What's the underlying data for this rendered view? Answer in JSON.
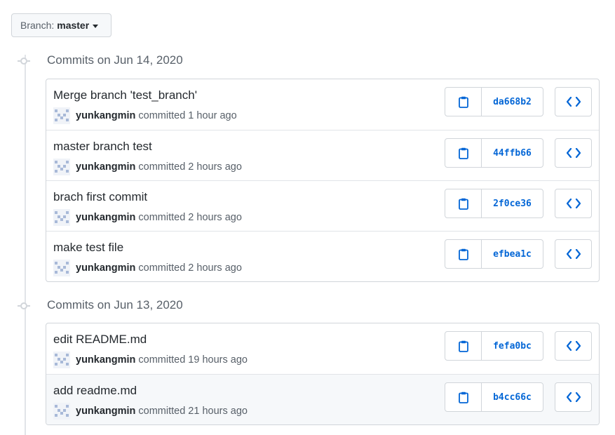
{
  "branch": {
    "label": "Branch:",
    "value": "master"
  },
  "groups": [
    {
      "title": "Commits on Jun 14, 2020",
      "commits": [
        {
          "message": "Merge branch 'test_branch'",
          "author": "yunkangmin",
          "action": "committed",
          "age": "1 hour ago",
          "sha": "da668b2"
        },
        {
          "message": "master branch test",
          "author": "yunkangmin",
          "action": "committed",
          "age": "2 hours ago",
          "sha": "44ffb66"
        },
        {
          "message": "brach first commit",
          "author": "yunkangmin",
          "action": "committed",
          "age": "2 hours ago",
          "sha": "2f0ce36"
        },
        {
          "message": "make test file",
          "author": "yunkangmin",
          "action": "committed",
          "age": "2 hours ago",
          "sha": "efbea1c"
        }
      ]
    },
    {
      "title": "Commits on Jun 13, 2020",
      "commits": [
        {
          "message": "edit README.md",
          "author": "yunkangmin",
          "action": "committed",
          "age": "19 hours ago",
          "sha": "fefa0bc"
        },
        {
          "message": "add readme.md",
          "author": "yunkangmin",
          "action": "committed",
          "age": "21 hours ago",
          "sha": "b4cc66c"
        }
      ]
    }
  ],
  "icons": {
    "copy": "clipboard-icon",
    "browse": "code-icon",
    "timeline": "commit-icon",
    "caret": "caret-down-icon"
  },
  "colors": {
    "link": "#0366d6",
    "border": "#d1d5da",
    "muted": "#586069",
    "highlight_row": "#f6f8fa"
  }
}
